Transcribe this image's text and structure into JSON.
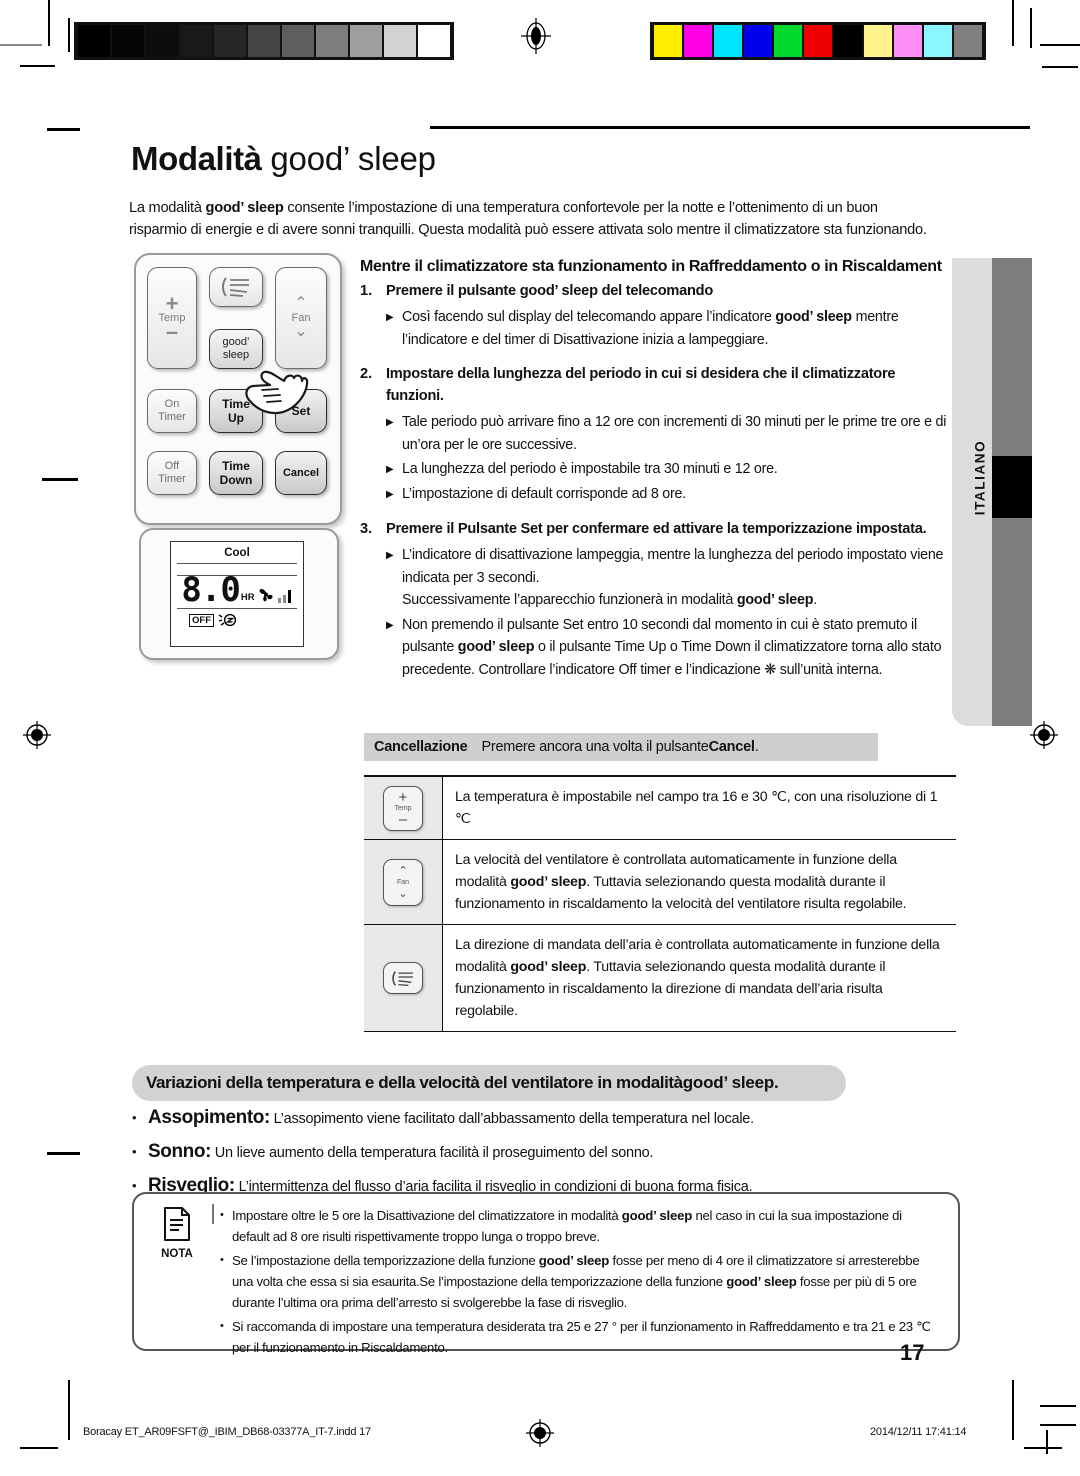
{
  "document": {
    "title": "Modalità good’ sleep",
    "title_plain": "Modalità ",
    "title_brand": "good’ sleep",
    "page_number": "17",
    "language_tab": "ITALIANO"
  },
  "intro": {
    "text_before": "La modalità ",
    "brand": "good’ sleep",
    "text_after": " consente l’impostazione di una temperatura confortevole per la notte e l’ottenimento di un buon risparmio di energie e di avere sonni tranquilli. Questa modalità può essere attivata solo mentre il climatizzatore sta funzionando."
  },
  "section_heading": "Mentre il climatizzatore sta funzionamento in Raffreddamento o in Riscaldament",
  "steps": [
    {
      "number": "1.",
      "title_before": "Premere il pulsante ",
      "title_brand": "good’ sleep",
      "title_after": " del telecomando",
      "bullets": [
        {
          "before": "Così facendo sul display del telecomando appare l’indicatore ",
          "brand": "good’ sleep",
          "after": " mentre l’indicatore e del timer di Disattivazione inizia a lampeggiare."
        }
      ]
    },
    {
      "number": "2.",
      "title_before": "Impostare della lunghezza del periodo in cui si desidera che il climatizzatore funzioni.",
      "title_brand": "",
      "title_after": "",
      "bullets": [
        {
          "before": "Tale periodo può arrivare fino a 12 ore con incrementi di 30 minuti per le prime tre ore e di un’ora per le ore successive.",
          "brand": "",
          "after": ""
        },
        {
          "before": " La lunghezza del periodo è impostabile tra 30 minuti e 12 ore.",
          "brand": "",
          "after": ""
        },
        {
          "before": " L’impostazione di default corrisponde ad 8 ore.",
          "brand": "",
          "after": ""
        }
      ]
    },
    {
      "number": "3.",
      "title_before": "Premere il Pulsante Set per confermare ed attivare  la temporizzazione impostata.",
      "title_brand": "",
      "title_after": "",
      "bullets": [
        {
          "before": "L’indicatore di disattivazione lampeggia, mentre la lunghezza del periodo impostato viene indicata per 3 secondi.\nSuccessivamente l’apparecchio funzionerà in modalità ",
          "brand": "good’ sleep",
          "after": "."
        },
        {
          "before": "Non premendo il pulsante Set entro 10 secondi dal momento in cui è stato premuto il pulsante ",
          "brand": "good’ sleep",
          "after": " o il pulsante Time Up o Time Down il climatizzatore torna allo stato precedente.  Controllare l’indicatore Off timer e l’indicazione ❋ sull’unità interna."
        }
      ]
    }
  ],
  "cancellation": {
    "label": "Cancellazione",
    "text_before": "Premere ancora una volta il pulsante ",
    "button": "Cancel",
    "text_after": "."
  },
  "spec_table": [
    {
      "icon": "temp-key-icon",
      "icon_label": "Temp",
      "text_before": "La temperatura è impostabile nel campo tra 16 e 30 ℃, con una risoluzione di 1 ℃",
      "brand": "",
      "text_after": ""
    },
    {
      "icon": "fan-key-icon",
      "icon_label": "Fan",
      "text_before": "La velocità del ventilatore è controllata automaticamente in funzione della modalità ",
      "brand": "good’ sleep",
      "text_after": ". Tuttavia selezionando questa modalità durante il funzionamento in riscaldamento la velocità del ventilatore risulta regolabile."
    },
    {
      "icon": "airflow-key-icon",
      "icon_label": "",
      "text_before": "La direzione di mandata dell’aria è controllata automaticamente in funzione della modalità ",
      "brand": "good’ sleep",
      "text_after": ". Tuttavia selezionando questa modalità durante il funzionamento in riscaldamento la direzione di mandata dell’aria risulta regolabile."
    }
  ],
  "remote": {
    "keys": [
      {
        "name": "temp-key",
        "line1": "+",
        "label": "Temp",
        "line2": "–"
      },
      {
        "name": "airflow-key",
        "line1": "",
        "label": "",
        "line2": ""
      },
      {
        "name": "fan-key",
        "line1": "∧",
        "label": "Fan",
        "line2": "∨"
      },
      {
        "name": "goodsleep-key",
        "line1": "good’",
        "label": "",
        "line2": "sleep"
      },
      {
        "name": "on-timer-key",
        "line1": "On",
        "label": "",
        "line2": "Timer"
      },
      {
        "name": "time-up-key",
        "line1": "Time",
        "label": "",
        "line2": "Up"
      },
      {
        "name": "set-key",
        "line1": "Set",
        "label": "",
        "line2": ""
      },
      {
        "name": "off-timer-key",
        "line1": "Off",
        "label": "",
        "line2": "Timer"
      },
      {
        "name": "time-down-key",
        "line1": "Time",
        "label": "",
        "line2": "Down"
      },
      {
        "name": "cancel-key",
        "line1": "Cancel",
        "label": "",
        "line2": ""
      }
    ]
  },
  "lcd": {
    "mode": "Cool",
    "value": "8.0",
    "unit": "HR",
    "off_tag": "OFF"
  },
  "variations": {
    "banner_before": "Variazioni della temperatura e della velocità del ventilatore in modalità ",
    "banner_brand": "good’ sleep.",
    "items": [
      {
        "term": "Assopimento:",
        "desc": " L’assopimento viene facilitato dall’abbassamento della temperatura nel locale."
      },
      {
        "term": "Sonno:",
        "desc": " Un lieve aumento della temperatura facilità il proseguimento del sonno."
      },
      {
        "term": "Risveglio:",
        "desc": " L’intermittenza del flusso d’aria facilita il risveglio in condizioni di buona forma fisica."
      }
    ]
  },
  "nota": {
    "label": "NOTA",
    "items": [
      {
        "before": "Impostare oltre le 5 ore la Disattivazione del climatizzatore in modalità ",
        "brand": "good’ sleep",
        "after": " nel caso in cui la sua impostazione di default ad 8 ore risulti rispettivamente troppo lunga o troppo breve."
      },
      {
        "before": "Se l’impostazione della temporizzazione della funzione ",
        "brand": "good’ sleep",
        "after": " fosse per meno di 4 ore il climatizzatore si arresterebbe una volta che essa si sia esaurita.Se l’impostazione della temporizzazione della funzione ",
        "brand2": "good’ sleep",
        "after2": " fosse per più di 5 ore durante l’ultima ora prima dell’arresto si svolgerebbe la fase di risveglio."
      },
      {
        "before": "Si raccomanda di impostare una temperatura desiderata tra 25 e 27 ° per il funzionamento in Raffreddamento e tra 21 e 23 ℃ per il funzionamento in Riscaldamento.",
        "brand": "",
        "after": ""
      }
    ]
  },
  "footer": {
    "left": "Boracay ET_AR09FSFT@_IBIM_DB68-03377A_IT-7.indd   17",
    "right": "2014/12/11   17:41:14"
  },
  "calibration": {
    "grayscale": [
      "#000000",
      "#050505",
      "#0d0d0d",
      "#191919",
      "#262626",
      "#454545",
      "#5e5e5e",
      "#7d7d7d",
      "#9e9e9e",
      "#d2d2d2",
      "#ffffff"
    ],
    "colors": [
      "#ffee00",
      "#ff00e6",
      "#00e5ff",
      "#0000ee",
      "#00d92b",
      "#ee0000",
      "#000000",
      "#fff38a",
      "#ff8ef7",
      "#8af6ff",
      "#808080"
    ]
  }
}
